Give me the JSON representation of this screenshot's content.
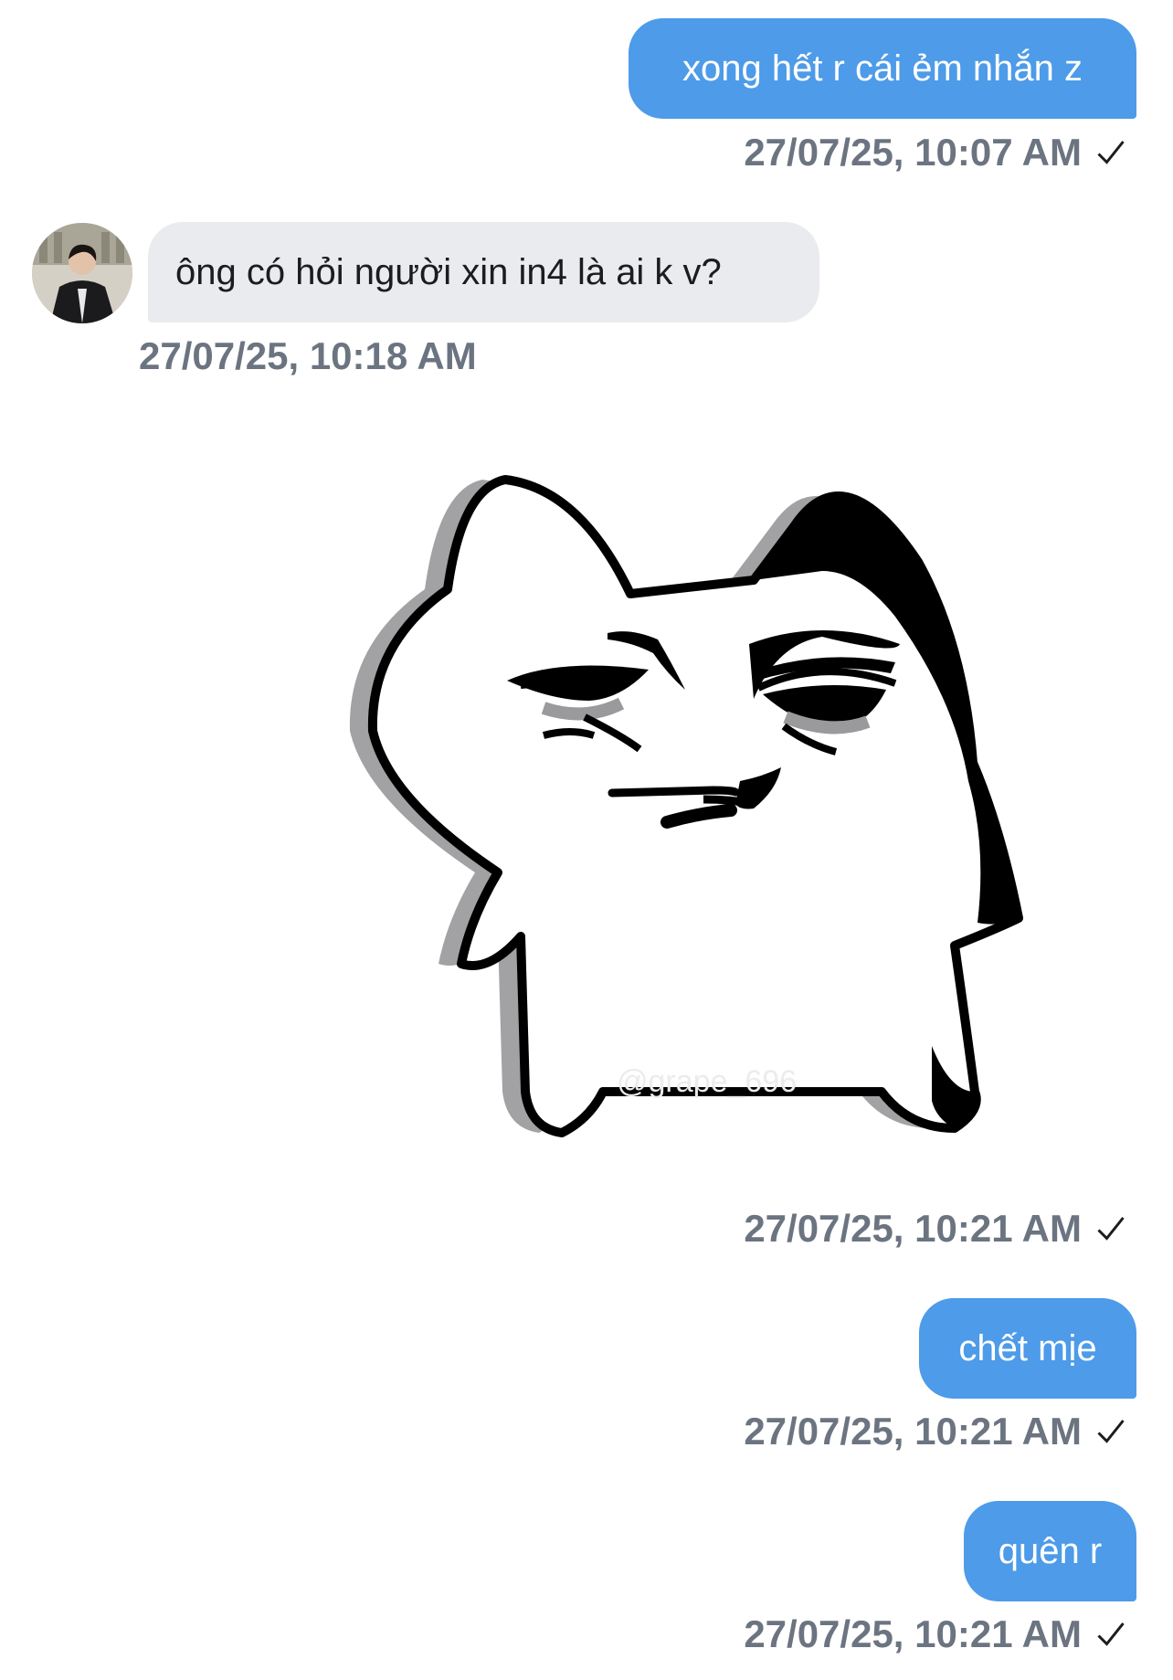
{
  "messages": [
    {
      "direction": "outgoing",
      "type": "text",
      "text": "xong hết r cái ẻm nhắn z",
      "timestamp": "27/07/25, 10:07 AM",
      "status": "sent"
    },
    {
      "direction": "incoming",
      "type": "text",
      "text": "ông có hỏi người xin in4 là ai k v?",
      "timestamp": "27/07/25, 10:18 AM"
    },
    {
      "direction": "outgoing",
      "type": "sticker",
      "sticker_icon": "smug-cat-sticker",
      "sticker_watermark": "@grape_696",
      "timestamp": "27/07/25, 10:21 AM",
      "status": "sent"
    },
    {
      "direction": "outgoing",
      "type": "text",
      "text": "chết mịe",
      "timestamp": "27/07/25, 10:21 AM",
      "status": "sent"
    },
    {
      "direction": "outgoing",
      "type": "text",
      "text": "quên r",
      "timestamp": "27/07/25, 10:21 AM",
      "status": "sent"
    }
  ],
  "colors": {
    "outgoing_bubble": "#4d9be9",
    "incoming_bubble": "#e9ebee",
    "timestamp_text": "#6b7480",
    "background": "#ffffff"
  }
}
